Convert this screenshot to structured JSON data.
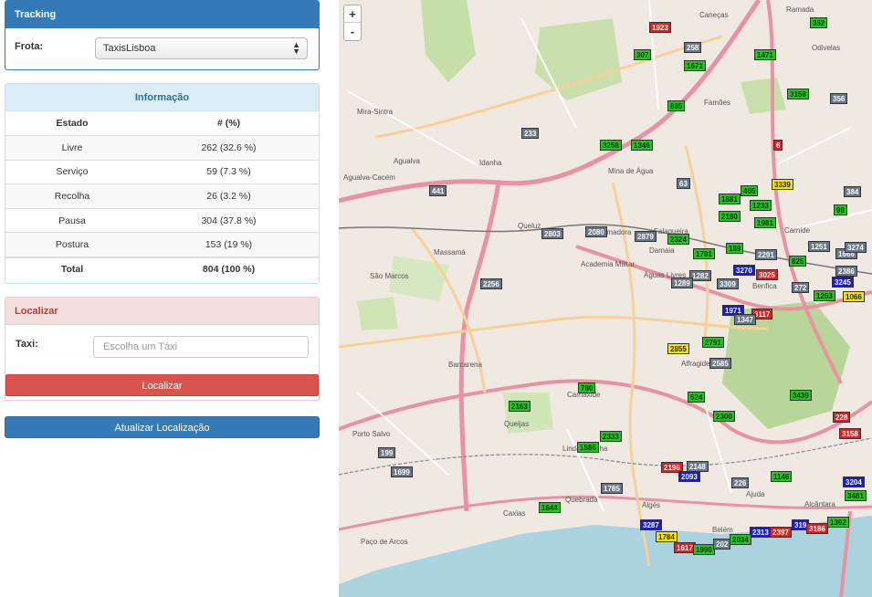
{
  "tracking": {
    "title": "Tracking",
    "frota_label": "Frota:",
    "frota_value": "TaxisLisboa"
  },
  "informacao": {
    "title": "Informação",
    "headers": [
      "Estado",
      "# (%)"
    ],
    "rows": [
      {
        "estado": "Livre",
        "valor": "262 (32.6 %)"
      },
      {
        "estado": "Serviço",
        "valor": "59 (7.3 %)"
      },
      {
        "estado": "Recolha",
        "valor": "26 (3.2 %)"
      },
      {
        "estado": "Pausa",
        "valor": "304 (37.8 %)"
      },
      {
        "estado": "Postura",
        "valor": "153 (19 %)"
      }
    ],
    "total_label": "Total",
    "total_value": "804 (100 %)"
  },
  "localizar": {
    "title": "Localizar",
    "taxi_label": "Taxi:",
    "placeholder": "Escolha um Táxi",
    "button": "Localizar"
  },
  "update_button": "Atualizar Localização",
  "map": {
    "zoom_in": "+",
    "zoom_out": "-",
    "places": [
      "Mira-Sintra",
      "Agualva",
      "Agualva-Cacém",
      "Idanha",
      "Massamá",
      "Queluz",
      "Mina de Água",
      "São Marcos",
      "Barcarena",
      "Carnaxide",
      "Queijas",
      "Porto Salvo",
      "Linda-a-Velha",
      "Paço de Arcos",
      "Alfragide",
      "Benfica",
      "Carnide",
      "Odivelas",
      "Ramada",
      "Famões",
      "Caneças",
      "Ajuda",
      "Belém",
      "Algés",
      "Águas Livres",
      "Amadora",
      "Falagueira",
      "Caxias",
      "Quebrada",
      "Academia Militar",
      "Alcântara",
      "Damaia"
    ],
    "taxis": [
      {
        "n": "1923",
        "c": "r"
      },
      {
        "n": "258",
        "c": "s"
      },
      {
        "n": "307",
        "c": "g"
      },
      {
        "n": "1671",
        "c": "g"
      },
      {
        "n": "1471",
        "c": "g"
      },
      {
        "n": "352",
        "c": "g"
      },
      {
        "n": "3158",
        "c": "g"
      },
      {
        "n": "356",
        "c": "s"
      },
      {
        "n": "885",
        "c": "g"
      },
      {
        "n": "233",
        "c": "s"
      },
      {
        "n": "3258",
        "c": "g"
      },
      {
        "n": "1346",
        "c": "g"
      },
      {
        "n": "6",
        "c": "r"
      },
      {
        "n": "441",
        "c": "s"
      },
      {
        "n": "63",
        "c": "s"
      },
      {
        "n": "465",
        "c": "g"
      },
      {
        "n": "3339",
        "c": "y"
      },
      {
        "n": "1881",
        "c": "g"
      },
      {
        "n": "1233",
        "c": "g"
      },
      {
        "n": "2180",
        "c": "g"
      },
      {
        "n": "1981",
        "c": "g"
      },
      {
        "n": "2803",
        "c": "s"
      },
      {
        "n": "2080",
        "c": "s"
      },
      {
        "n": "2879",
        "c": "s"
      },
      {
        "n": "2324",
        "c": "g"
      },
      {
        "n": "1701",
        "c": "g"
      },
      {
        "n": "189",
        "c": "g"
      },
      {
        "n": "2291",
        "c": "s"
      },
      {
        "n": "3270",
        "c": "b"
      },
      {
        "n": "3025",
        "c": "r"
      },
      {
        "n": "825",
        "c": "g"
      },
      {
        "n": "1251",
        "c": "s"
      },
      {
        "n": "1666",
        "c": "s"
      },
      {
        "n": "1282",
        "c": "s"
      },
      {
        "n": "2256",
        "c": "s"
      },
      {
        "n": "1289",
        "c": "s"
      },
      {
        "n": "3309",
        "c": "s"
      },
      {
        "n": "272",
        "c": "s"
      },
      {
        "n": "1253",
        "c": "g"
      },
      {
        "n": "1066",
        "c": "y"
      },
      {
        "n": "1971",
        "c": "b"
      },
      {
        "n": "3117",
        "c": "r"
      },
      {
        "n": "1347",
        "c": "s"
      },
      {
        "n": "2855",
        "c": "y"
      },
      {
        "n": "2791",
        "c": "g"
      },
      {
        "n": "2585",
        "c": "s"
      },
      {
        "n": "780",
        "c": "g"
      },
      {
        "n": "524",
        "c": "g"
      },
      {
        "n": "3439",
        "c": "g"
      },
      {
        "n": "2163",
        "c": "g"
      },
      {
        "n": "2300",
        "c": "g"
      },
      {
        "n": "228",
        "c": "r"
      },
      {
        "n": "3158",
        "c": "r"
      },
      {
        "n": "2333",
        "c": "g"
      },
      {
        "n": "1586",
        "c": "g"
      },
      {
        "n": "199",
        "c": "s"
      },
      {
        "n": "1699",
        "c": "s"
      },
      {
        "n": "2196",
        "c": "r"
      },
      {
        "n": "2148",
        "c": "s"
      },
      {
        "n": "2093",
        "c": "b"
      },
      {
        "n": "226",
        "c": "s"
      },
      {
        "n": "1146",
        "c": "g"
      },
      {
        "n": "3204",
        "c": "b"
      },
      {
        "n": "3481",
        "c": "g"
      },
      {
        "n": "1785",
        "c": "s"
      },
      {
        "n": "1644",
        "c": "g"
      },
      {
        "n": "3287",
        "c": "b"
      },
      {
        "n": "1784",
        "c": "y"
      },
      {
        "n": "2313",
        "c": "b"
      },
      {
        "n": "2397",
        "c": "r"
      },
      {
        "n": "319",
        "c": "b"
      },
      {
        "n": "3186",
        "c": "r"
      },
      {
        "n": "1617",
        "c": "r"
      },
      {
        "n": "1990",
        "c": "g"
      },
      {
        "n": "2034",
        "c": "g"
      },
      {
        "n": "202",
        "c": "s"
      },
      {
        "n": "384",
        "c": "s"
      },
      {
        "n": "98",
        "c": "g"
      },
      {
        "n": "3245",
        "c": "b"
      },
      {
        "n": "3274",
        "c": "s"
      },
      {
        "n": "2386",
        "c": "s"
      },
      {
        "n": "1392",
        "c": "g"
      }
    ]
  },
  "colors": {
    "primary": "#337ab7",
    "info_bg": "#d9edf7",
    "danger": "#d9534f",
    "danger_bg": "#f2dede"
  }
}
